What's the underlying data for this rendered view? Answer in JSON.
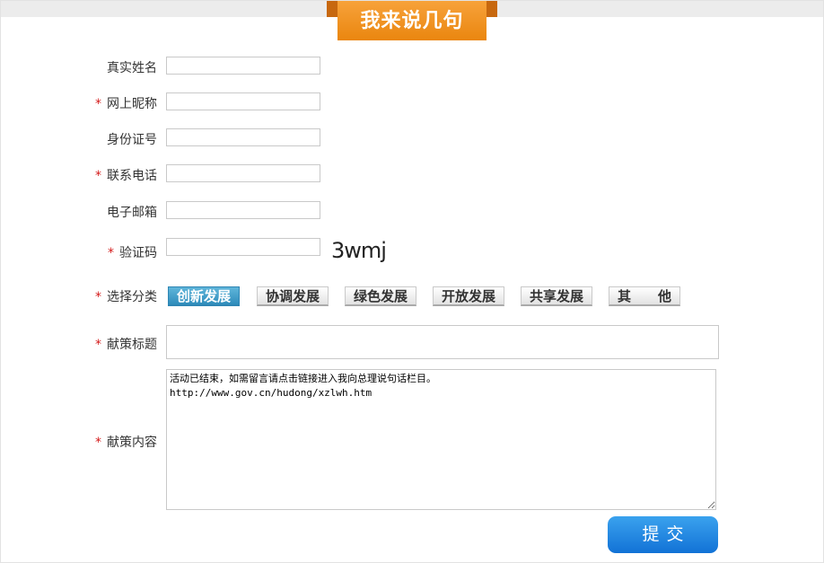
{
  "header": {
    "title": "我来说几句"
  },
  "form": {
    "real_name": {
      "label": "真实姓名",
      "required": false,
      "value": ""
    },
    "nickname": {
      "label": "网上昵称",
      "required": true,
      "value": ""
    },
    "id_number": {
      "label": "身份证号",
      "required": false,
      "value": ""
    },
    "phone": {
      "label": "联系电话",
      "required": true,
      "value": ""
    },
    "email": {
      "label": "电子邮箱",
      "required": false,
      "value": ""
    },
    "captcha": {
      "label": "验证码",
      "required": true,
      "value": "",
      "code": "3wmj"
    },
    "category": {
      "label": "选择分类",
      "required": true,
      "options": [
        "创新发展",
        "协调发展",
        "绿色发展",
        "开放发展",
        "共享发展",
        "其　　他"
      ],
      "selected": "创新发展"
    },
    "suggestion_title": {
      "label": "献策标题",
      "required": true,
      "value": ""
    },
    "suggestion_content": {
      "label": "献策内容",
      "required": true,
      "value": "活动已结束，如需留言请点击链接进入我向总理说句话栏目。\nhttp://www.gov.cn/hudong/xzlwh.htm"
    },
    "required_mark": "*",
    "submit_label": "提交"
  },
  "colors": {
    "accent_orange": "#ea860f",
    "active_blue": "#2f8dbc",
    "submit_blue": "#1272d6",
    "required_red": "#d41a1a"
  }
}
